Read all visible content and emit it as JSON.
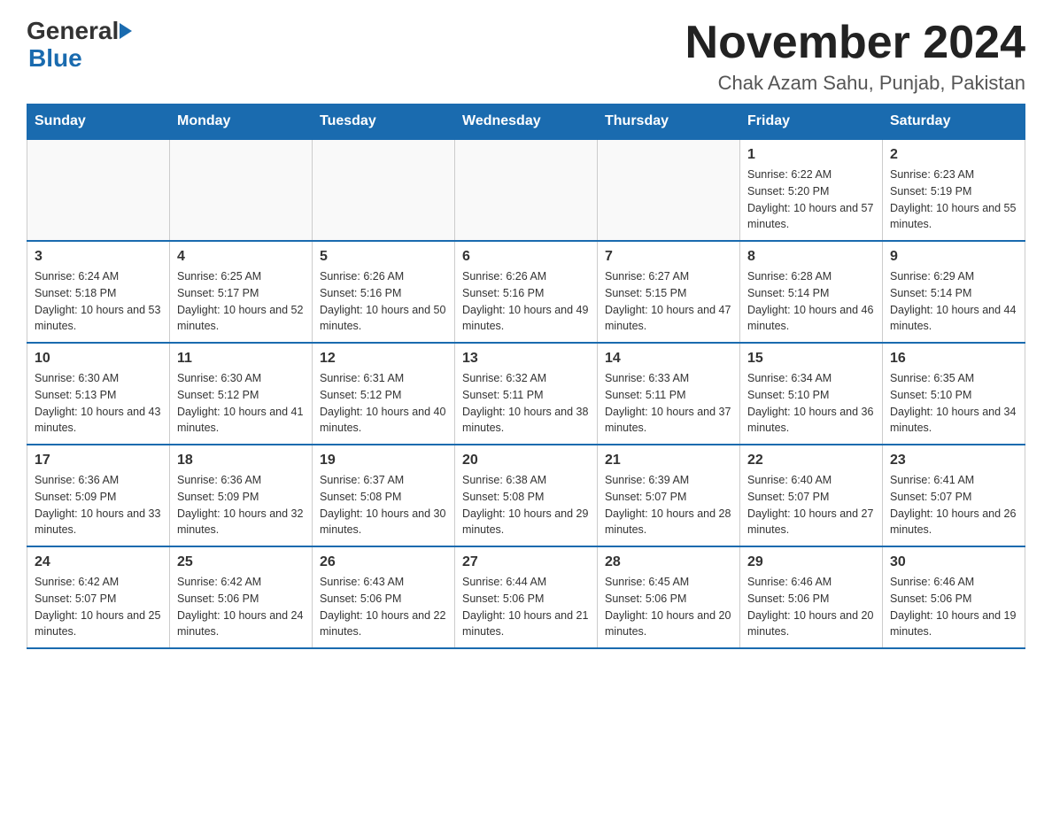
{
  "header": {
    "logo": {
      "general": "General",
      "blue": "Blue"
    },
    "title": "November 2024",
    "subtitle": "Chak Azam Sahu, Punjab, Pakistan"
  },
  "calendar": {
    "days_of_week": [
      "Sunday",
      "Monday",
      "Tuesday",
      "Wednesday",
      "Thursday",
      "Friday",
      "Saturday"
    ],
    "weeks": [
      [
        {
          "day": "",
          "info": ""
        },
        {
          "day": "",
          "info": ""
        },
        {
          "day": "",
          "info": ""
        },
        {
          "day": "",
          "info": ""
        },
        {
          "day": "",
          "info": ""
        },
        {
          "day": "1",
          "info": "Sunrise: 6:22 AM\nSunset: 5:20 PM\nDaylight: 10 hours and 57 minutes."
        },
        {
          "day": "2",
          "info": "Sunrise: 6:23 AM\nSunset: 5:19 PM\nDaylight: 10 hours and 55 minutes."
        }
      ],
      [
        {
          "day": "3",
          "info": "Sunrise: 6:24 AM\nSunset: 5:18 PM\nDaylight: 10 hours and 53 minutes."
        },
        {
          "day": "4",
          "info": "Sunrise: 6:25 AM\nSunset: 5:17 PM\nDaylight: 10 hours and 52 minutes."
        },
        {
          "day": "5",
          "info": "Sunrise: 6:26 AM\nSunset: 5:16 PM\nDaylight: 10 hours and 50 minutes."
        },
        {
          "day": "6",
          "info": "Sunrise: 6:26 AM\nSunset: 5:16 PM\nDaylight: 10 hours and 49 minutes."
        },
        {
          "day": "7",
          "info": "Sunrise: 6:27 AM\nSunset: 5:15 PM\nDaylight: 10 hours and 47 minutes."
        },
        {
          "day": "8",
          "info": "Sunrise: 6:28 AM\nSunset: 5:14 PM\nDaylight: 10 hours and 46 minutes."
        },
        {
          "day": "9",
          "info": "Sunrise: 6:29 AM\nSunset: 5:14 PM\nDaylight: 10 hours and 44 minutes."
        }
      ],
      [
        {
          "day": "10",
          "info": "Sunrise: 6:30 AM\nSunset: 5:13 PM\nDaylight: 10 hours and 43 minutes."
        },
        {
          "day": "11",
          "info": "Sunrise: 6:30 AM\nSunset: 5:12 PM\nDaylight: 10 hours and 41 minutes."
        },
        {
          "day": "12",
          "info": "Sunrise: 6:31 AM\nSunset: 5:12 PM\nDaylight: 10 hours and 40 minutes."
        },
        {
          "day": "13",
          "info": "Sunrise: 6:32 AM\nSunset: 5:11 PM\nDaylight: 10 hours and 38 minutes."
        },
        {
          "day": "14",
          "info": "Sunrise: 6:33 AM\nSunset: 5:11 PM\nDaylight: 10 hours and 37 minutes."
        },
        {
          "day": "15",
          "info": "Sunrise: 6:34 AM\nSunset: 5:10 PM\nDaylight: 10 hours and 36 minutes."
        },
        {
          "day": "16",
          "info": "Sunrise: 6:35 AM\nSunset: 5:10 PM\nDaylight: 10 hours and 34 minutes."
        }
      ],
      [
        {
          "day": "17",
          "info": "Sunrise: 6:36 AM\nSunset: 5:09 PM\nDaylight: 10 hours and 33 minutes."
        },
        {
          "day": "18",
          "info": "Sunrise: 6:36 AM\nSunset: 5:09 PM\nDaylight: 10 hours and 32 minutes."
        },
        {
          "day": "19",
          "info": "Sunrise: 6:37 AM\nSunset: 5:08 PM\nDaylight: 10 hours and 30 minutes."
        },
        {
          "day": "20",
          "info": "Sunrise: 6:38 AM\nSunset: 5:08 PM\nDaylight: 10 hours and 29 minutes."
        },
        {
          "day": "21",
          "info": "Sunrise: 6:39 AM\nSunset: 5:07 PM\nDaylight: 10 hours and 28 minutes."
        },
        {
          "day": "22",
          "info": "Sunrise: 6:40 AM\nSunset: 5:07 PM\nDaylight: 10 hours and 27 minutes."
        },
        {
          "day": "23",
          "info": "Sunrise: 6:41 AM\nSunset: 5:07 PM\nDaylight: 10 hours and 26 minutes."
        }
      ],
      [
        {
          "day": "24",
          "info": "Sunrise: 6:42 AM\nSunset: 5:07 PM\nDaylight: 10 hours and 25 minutes."
        },
        {
          "day": "25",
          "info": "Sunrise: 6:42 AM\nSunset: 5:06 PM\nDaylight: 10 hours and 24 minutes."
        },
        {
          "day": "26",
          "info": "Sunrise: 6:43 AM\nSunset: 5:06 PM\nDaylight: 10 hours and 22 minutes."
        },
        {
          "day": "27",
          "info": "Sunrise: 6:44 AM\nSunset: 5:06 PM\nDaylight: 10 hours and 21 minutes."
        },
        {
          "day": "28",
          "info": "Sunrise: 6:45 AM\nSunset: 5:06 PM\nDaylight: 10 hours and 20 minutes."
        },
        {
          "day": "29",
          "info": "Sunrise: 6:46 AM\nSunset: 5:06 PM\nDaylight: 10 hours and 20 minutes."
        },
        {
          "day": "30",
          "info": "Sunrise: 6:46 AM\nSunset: 5:06 PM\nDaylight: 10 hours and 19 minutes."
        }
      ]
    ]
  }
}
